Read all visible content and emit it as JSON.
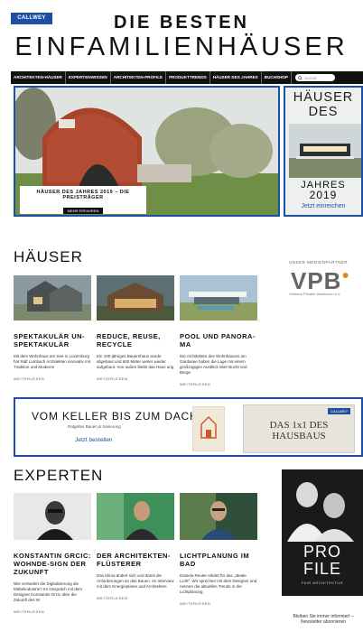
{
  "header": {
    "logo": "CALLWEY",
    "title_line1": "DIE BESTEN",
    "title_line2": "EINFAMILIENHÄUSER"
  },
  "nav": {
    "items": [
      "ARCHITEKTEN-HÄUSER",
      "EXPERTENWISSEN",
      "ARCHITEKTEN-PROFILE",
      "PRODUKTTRENDS",
      "HÄUSER DES JAHRES",
      "BUCHSHOP"
    ],
    "search_placeholder": "SUCHE"
  },
  "hero": {
    "caption_title": "HÄUSER DES JAHRES 2019 – DIE PREISTRÄGER",
    "caption_button": "MEHR ERFAHREN"
  },
  "jahres": {
    "line1": "HÄUSER",
    "line2": "DES",
    "line3": "JAHRES",
    "year": "2019",
    "link": "Jetzt einreichen"
  },
  "houses": {
    "heading": "HÄUSER",
    "cards": [
      {
        "title": "SPEKTAKULÄR UN-SPEKTAKULÄR",
        "text": "Mit dem Wohnhaus am See in Luxemburg hat Ralf Lumbach Architekten innovativ mit Tradition und Moderne",
        "more": "WEITERLESEN"
      },
      {
        "title": "REDUCE, REUSE, RECYCLE",
        "text": "Ein 100-jähriges Bauernhaus wurde abgebaut und 600 Meter weiter wieder aufgebaut. Von außen bleibt das Haus urig",
        "more": "WEITERLESEN"
      },
      {
        "title": "POOL UND PANORA-MA",
        "text": "Die Architekten des Wohnhauses am Gardasee haben die Lage mit einem großzügigen Ausblick über Bucht und Berge",
        "more": "WEITERLESEN"
      }
    ]
  },
  "partner": {
    "label": "UNSER MEDIENPARTNER",
    "logo": "VPB",
    "sub": "Verband Privater Bauherren e.V."
  },
  "banner": {
    "headline": "VOM KELLER BIS ZUM DACH",
    "subline": "Ratgeber Bauen & Sanierung",
    "link": "Jetzt bestellen",
    "book_title": "DAS 1x1 DES HAUSBAUS"
  },
  "experts": {
    "heading": "EXPERTEN",
    "cards": [
      {
        "title": "KONSTANTIN GRCIC: WOHNDE-SIGN DER ZUKUNFT",
        "text": "Wie verändert die Digitalisierung die Möbelindustrie? Im Gespräch mit dem Designer Konstantin Grcic über die Zukunft des W",
        "more": "WEITERLESEN"
      },
      {
        "title": "DER ARCHITEKTEN-FLÜSTERER",
        "text": "Das Klima ändert sich und damit die Anforderungen an das Bauen. Im Interview mit dem Energieplaner und Architekten",
        "more": "WEITERLESEN"
      },
      {
        "title": "LICHTPLANUNG IM BAD",
        "text": "Daniela Reuter erklärt für das „Ideale Licht“. Wir sprechen mit dem Designer und nennen die aktuellen Trends in der Lichtplanung",
        "more": "WEITERLESEN"
      }
    ]
  },
  "profile": {
    "pro": "PRO",
    "file": "FILE",
    "sub": "FAIR ARCHITEKTUR"
  },
  "newsletter": {
    "text": "Bleiben Sie immer informiert – Newsletter abonnieren"
  },
  "colors": {
    "accent": "#1d4fa3",
    "dark": "#111111"
  }
}
